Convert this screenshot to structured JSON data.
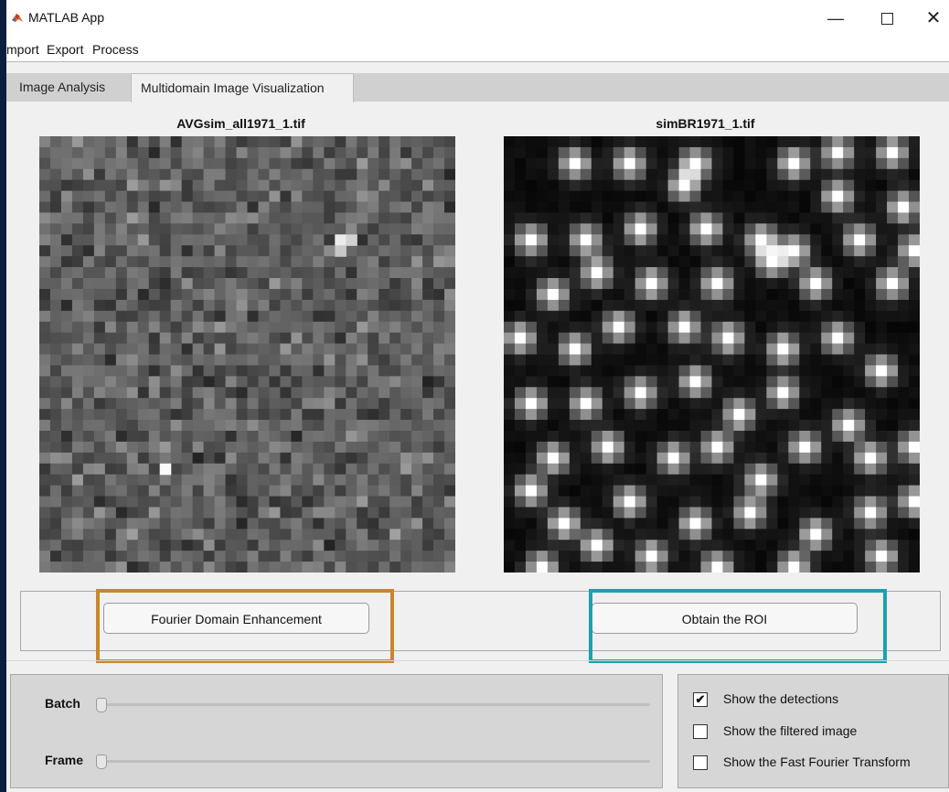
{
  "window": {
    "title": "MATLAB App",
    "controls": {
      "minimize": "—",
      "close": "✕"
    }
  },
  "menu": [
    "mport",
    "Export",
    "Process"
  ],
  "tabs": [
    {
      "label": "Image Analysis",
      "active": false
    },
    {
      "label": "Multidomain Image Visualization",
      "active": true
    }
  ],
  "images": {
    "left": {
      "title": "AVGsim_all1971_1.tif"
    },
    "right": {
      "title": "simBR1971_1.tif"
    }
  },
  "buttons": {
    "fourier": "Fourier Domain Enhancement",
    "roi": "Obtain the ROI"
  },
  "highlights": {
    "fourier_color": "#c8862f",
    "roi_color": "#1aa2b0"
  },
  "sliders": [
    {
      "label": "Batch",
      "value": 0
    },
    {
      "label": "Frame",
      "value": 0
    }
  ],
  "checkboxes": [
    {
      "label": "Show the detections",
      "checked": true
    },
    {
      "label": "Show the filtered image",
      "checked": false
    },
    {
      "label": "Show the Fast Fourier Transform",
      "checked": false
    }
  ],
  "icons": {
    "app": "matlab-icon",
    "check": "✔"
  }
}
